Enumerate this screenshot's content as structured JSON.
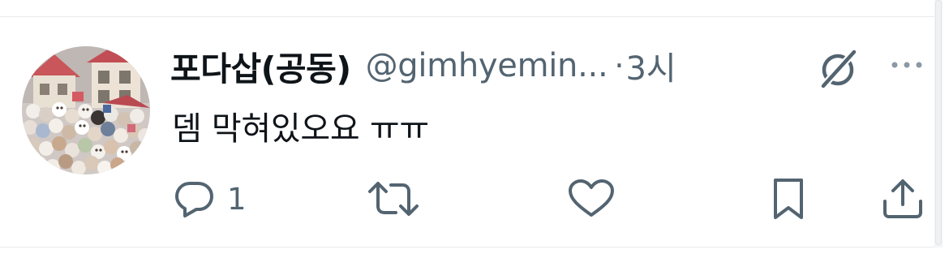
{
  "tweet": {
    "display_name": "포다삽(공동)",
    "handle": "@gimhyemin...",
    "separator": "·",
    "time": "3시",
    "text": "뎀 막혀있오요 ㅠㅠ"
  },
  "actions": {
    "reply_count": "1"
  },
  "icons": {
    "avatar": "avatar-image",
    "grok": "grok-icon",
    "more": "more-icon",
    "reply": "reply-icon",
    "retweet": "retweet-icon",
    "like": "like-icon",
    "bookmark": "bookmark-icon",
    "share": "share-icon"
  },
  "colors": {
    "text": "#0f1419",
    "secondary": "#536471",
    "divider": "#e8ebee"
  }
}
